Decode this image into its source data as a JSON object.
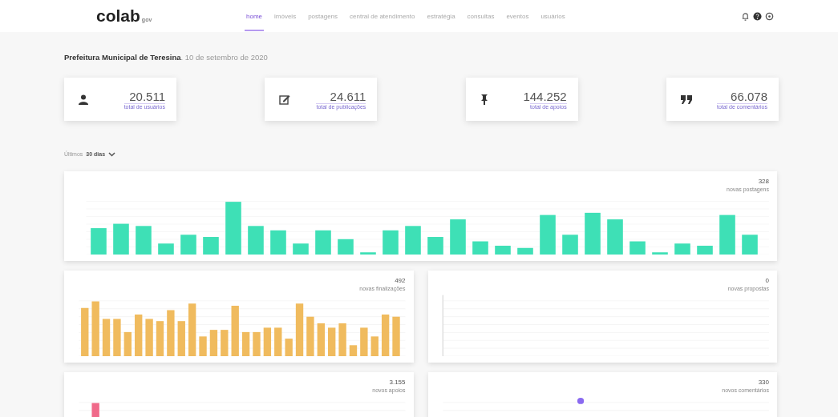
{
  "header": {
    "logo": "colab",
    "logo_suffix": "gov"
  },
  "nav": [
    {
      "label": "home",
      "selected": true
    },
    {
      "label": "imóveis",
      "selected": false
    },
    {
      "label": "postagens",
      "selected": false
    },
    {
      "label": "central de atendimento",
      "selected": false
    },
    {
      "label": "estratégia",
      "selected": false
    },
    {
      "label": "consultas",
      "selected": false
    },
    {
      "label": "eventos",
      "selected": false
    },
    {
      "label": "usuários",
      "selected": false
    }
  ],
  "heading": {
    "org": "Prefeitura Municipal de Teresina",
    "date": ". 10 de setembro de 2020"
  },
  "stats": [
    {
      "value": "20.511",
      "label": "total de usuários"
    },
    {
      "value": "24.611",
      "label": "total de publicações"
    },
    {
      "value": "144.252",
      "label": "total de apoios"
    },
    {
      "value": "66.078",
      "label": "total de comentários"
    }
  ],
  "period": {
    "prefix": "Últimos",
    "value": "30 dias"
  },
  "panels": [
    {
      "total": "328",
      "caption": "novas postagens",
      "color": "#3ee0b6",
      "kind": "bars"
    },
    {
      "total": "492",
      "caption": "novas finalizações",
      "color": "#f0bb5e",
      "kind": "bars"
    },
    {
      "total": "0",
      "caption": "novas propostas",
      "kind": "empty"
    },
    {
      "total": "3.155",
      "caption": "novos apoios",
      "color": "#f06a8a",
      "kind": "bars"
    },
    {
      "total": "330",
      "caption": "novos comentários",
      "color": "#8a6af0",
      "kind": "dots"
    }
  ]
}
